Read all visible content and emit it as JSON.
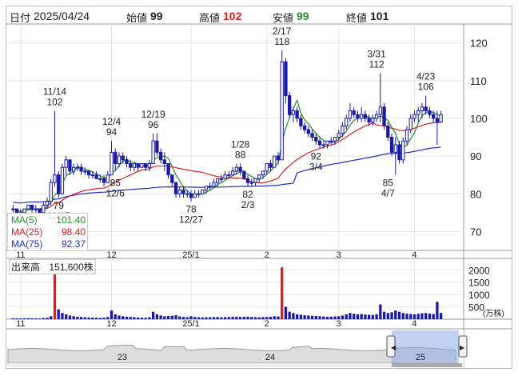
{
  "header": {
    "date_label": "日付",
    "date": "2025/04/24",
    "open_label": "始値",
    "open": "99",
    "high_label": "高値",
    "high": "102",
    "low_label": "安値",
    "low": "99",
    "close_label": "終値",
    "close": "101"
  },
  "colors": {
    "up_candle": "#1a1aa6",
    "down_candle": "#1a1aa6",
    "ma5": "#2e8b2e",
    "ma25": "#e02020",
    "ma75": "#2030c0",
    "vol_bar": "#1a1aa6",
    "vol_high": "#e02020",
    "high_value": "#e02020",
    "low_value": "#2e8b2e"
  },
  "ma_legend": [
    {
      "label": "MA(5)",
      "value": "101.40"
    },
    {
      "label": "MA(25)",
      "value": "98.40"
    },
    {
      "label": "MA(75)",
      "value": "92.37"
    }
  ],
  "volume_legend": {
    "label": "出来高",
    "value": "151,600株"
  },
  "price_axis": {
    "ticks": [
      "120",
      "110",
      "100",
      "90",
      "80",
      "70"
    ],
    "values": [
      120,
      110,
      100,
      90,
      80,
      70
    ],
    "ylim": [
      65,
      125
    ]
  },
  "volume_axis": {
    "ticks": [
      "2000",
      "1500",
      "1000",
      "500"
    ],
    "values": [
      2000,
      1500,
      1000,
      500
    ],
    "unit": "(万株)",
    "ylim": [
      0,
      2300
    ]
  },
  "month_labels": [
    "11",
    "12",
    "25/1",
    "2",
    "3",
    "4"
  ],
  "navigator_labels": [
    "23",
    "24",
    "25"
  ],
  "annotations": [
    {
      "date": "11/14",
      "value": "102"
    },
    {
      "date": "12/4",
      "value": "94"
    },
    {
      "date": "12/19",
      "value": "96"
    },
    {
      "date": "1/28",
      "value": "88"
    },
    {
      "date": "2/17",
      "value": "118"
    },
    {
      "date": "3/31",
      "value": "112"
    },
    {
      "date": "4/23",
      "value": "106"
    },
    {
      "date": "11/15",
      "value": "79"
    },
    {
      "date": "12/6",
      "value": "85"
    },
    {
      "date": "12/27",
      "value": "78"
    },
    {
      "date": "2/3",
      "value": "82"
    },
    {
      "date": "3/4",
      "value": "92"
    },
    {
      "date": "4/7",
      "value": "85"
    }
  ],
  "chart_data": {
    "type": "candlestick",
    "x_range": [
      "2024/10/28",
      "2025/04/24"
    ],
    "candles": [
      [
        76,
        77,
        75,
        76
      ],
      [
        76,
        76,
        75,
        75
      ],
      [
        75,
        76,
        74,
        75
      ],
      [
        75,
        76,
        75,
        76
      ],
      [
        76,
        77,
        76,
        77
      ],
      [
        77,
        77,
        75,
        76
      ],
      [
        76,
        77,
        75,
        76
      ],
      [
        76,
        76,
        74,
        75
      ],
      [
        75,
        78,
        75,
        77
      ],
      [
        77,
        79,
        76,
        78
      ],
      [
        78,
        84,
        77,
        83
      ],
      [
        83,
        102,
        82,
        85
      ],
      [
        85,
        86,
        79,
        80
      ],
      [
        80,
        88,
        80,
        87
      ],
      [
        87,
        90,
        85,
        89
      ],
      [
        89,
        89,
        85,
        86
      ],
      [
        86,
        88,
        85,
        87
      ],
      [
        87,
        88,
        86,
        87
      ],
      [
        87,
        88,
        85,
        86
      ],
      [
        86,
        87,
        85,
        86
      ],
      [
        86,
        86,
        84,
        85
      ],
      [
        85,
        86,
        84,
        85
      ],
      [
        85,
        86,
        84,
        84
      ],
      [
        84,
        85,
        83,
        84
      ],
      [
        84,
        85,
        82,
        83
      ],
      [
        83,
        86,
        83,
        85
      ],
      [
        85,
        94,
        85,
        91
      ],
      [
        91,
        92,
        86,
        88
      ],
      [
        88,
        91,
        87,
        90
      ],
      [
        90,
        91,
        88,
        89
      ],
      [
        89,
        90,
        87,
        88
      ],
      [
        88,
        89,
        86,
        87
      ],
      [
        87,
        88,
        86,
        88
      ],
      [
        88,
        88,
        86,
        87
      ],
      [
        87,
        88,
        87,
        88
      ],
      [
        88,
        88,
        86,
        87
      ],
      [
        87,
        89,
        86,
        88
      ],
      [
        88,
        96,
        88,
        94
      ],
      [
        94,
        96,
        90,
        91
      ],
      [
        91,
        92,
        88,
        89
      ],
      [
        89,
        91,
        86,
        88
      ],
      [
        88,
        88,
        84,
        85
      ],
      [
        85,
        85,
        82,
        83
      ],
      [
        83,
        83,
        79,
        80
      ],
      [
        80,
        82,
        79,
        81
      ],
      [
        81,
        82,
        79,
        80
      ],
      [
        80,
        81,
        79,
        80
      ],
      [
        80,
        81,
        78,
        79
      ],
      [
        79,
        81,
        79,
        80
      ],
      [
        80,
        81,
        79,
        80
      ],
      [
        80,
        81,
        80,
        81
      ],
      [
        81,
        82,
        80,
        82
      ],
      [
        82,
        83,
        81,
        82
      ],
      [
        82,
        84,
        82,
        83
      ],
      [
        83,
        84,
        82,
        84
      ],
      [
        84,
        85,
        83,
        84
      ],
      [
        84,
        86,
        84,
        85
      ],
      [
        85,
        86,
        84,
        85
      ],
      [
        85,
        87,
        85,
        86
      ],
      [
        86,
        88,
        85,
        87
      ],
      [
        87,
        88,
        85,
        86
      ],
      [
        86,
        86,
        84,
        84
      ],
      [
        84,
        85,
        82,
        83
      ],
      [
        83,
        84,
        82,
        83
      ],
      [
        83,
        84,
        82,
        84
      ],
      [
        84,
        85,
        83,
        85
      ],
      [
        85,
        86,
        84,
        86
      ],
      [
        86,
        88,
        85,
        88
      ],
      [
        88,
        89,
        86,
        87
      ],
      [
        87,
        90,
        87,
        90
      ],
      [
        90,
        91,
        88,
        89
      ],
      [
        89,
        118,
        89,
        115
      ],
      [
        115,
        116,
        104,
        106
      ],
      [
        106,
        107,
        100,
        101
      ],
      [
        101,
        103,
        99,
        102
      ],
      [
        102,
        103,
        99,
        100
      ],
      [
        100,
        101,
        97,
        98
      ],
      [
        98,
        99,
        96,
        97
      ],
      [
        97,
        98,
        95,
        96
      ],
      [
        96,
        97,
        94,
        95
      ],
      [
        95,
        96,
        93,
        94
      ],
      [
        94,
        95,
        92,
        93
      ],
      [
        93,
        94,
        92,
        93
      ],
      [
        93,
        94,
        92,
        94
      ],
      [
        94,
        95,
        93,
        94
      ],
      [
        94,
        95,
        93,
        95
      ],
      [
        95,
        97,
        94,
        96
      ],
      [
        96,
        99,
        95,
        98
      ],
      [
        98,
        101,
        97,
        100
      ],
      [
        100,
        104,
        99,
        102
      ],
      [
        102,
        103,
        100,
        101
      ],
      [
        101,
        102,
        99,
        100
      ],
      [
        100,
        103,
        99,
        101
      ],
      [
        101,
        102,
        99,
        100
      ],
      [
        100,
        101,
        98,
        99
      ],
      [
        99,
        101,
        98,
        100
      ],
      [
        100,
        102,
        99,
        101
      ],
      [
        101,
        112,
        99,
        103
      ],
      [
        103,
        104,
        97,
        98
      ],
      [
        98,
        99,
        94,
        95
      ],
      [
        95,
        96,
        90,
        91
      ],
      [
        91,
        95,
        85,
        93
      ],
      [
        93,
        94,
        88,
        89
      ],
      [
        89,
        95,
        88,
        94
      ],
      [
        94,
        98,
        93,
        97
      ],
      [
        97,
        101,
        96,
        100
      ],
      [
        100,
        102,
        99,
        101
      ],
      [
        101,
        103,
        99,
        102
      ],
      [
        102,
        104,
        100,
        103
      ],
      [
        103,
        106,
        101,
        102
      ],
      [
        102,
        103,
        100,
        101
      ],
      [
        101,
        102,
        99,
        100
      ],
      [
        100,
        102,
        93,
        99
      ],
      [
        99,
        102,
        99,
        101
      ]
    ],
    "volume": [
      40,
      35,
      30,
      38,
      45,
      40,
      35,
      30,
      50,
      60,
      120,
      1900,
      400,
      250,
      200,
      150,
      120,
      100,
      90,
      80,
      70,
      65,
      60,
      55,
      60,
      90,
      350,
      200,
      150,
      120,
      100,
      90,
      80,
      70,
      65,
      60,
      80,
      300,
      200,
      150,
      120,
      130,
      140,
      160,
      110,
      90,
      80,
      120,
      90,
      80,
      70,
      75,
      80,
      85,
      90,
      80,
      85,
      90,
      95,
      100,
      90,
      95,
      100,
      90,
      85,
      80,
      85,
      90,
      100,
      120,
      110,
      2100,
      500,
      300,
      250,
      200,
      180,
      160,
      150,
      140,
      130,
      120,
      110,
      100,
      100,
      110,
      120,
      150,
      200,
      250,
      220,
      200,
      210,
      190,
      180,
      170,
      200,
      600,
      300,
      250,
      280,
      350,
      300,
      250,
      230,
      210,
      200,
      220,
      240,
      250,
      230,
      210,
      700,
      250
    ],
    "ma5": "computed",
    "ma25": "computed",
    "ma75": "computed"
  }
}
